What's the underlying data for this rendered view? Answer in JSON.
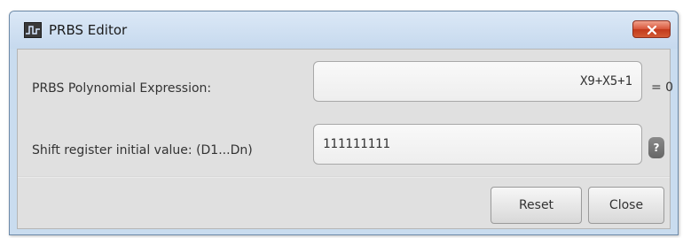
{
  "window": {
    "title": "PRBS Editor",
    "icon": "oscilloscope-app-icon",
    "close_icon": "close-icon"
  },
  "form": {
    "polynomial": {
      "label": "PRBS Polynomial Expression:",
      "value": "X9+X5+1",
      "suffix": "= 0"
    },
    "shift_register": {
      "label": "Shift register initial value: (D1...Dn)",
      "value": "111111111",
      "help_label": "?"
    }
  },
  "buttons": {
    "reset_label": "Reset",
    "close_label": "Close"
  },
  "colors": {
    "titlebar": "#c6d9ee",
    "close_button": "#c23a1c",
    "content_background": "#e0e0e0"
  }
}
